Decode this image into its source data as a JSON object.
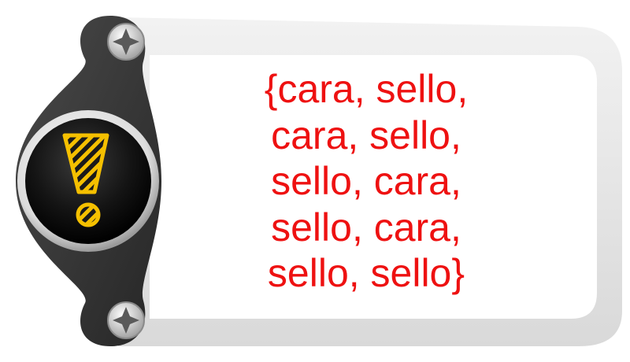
{
  "colors": {
    "text": "#ee1111",
    "frame_outer": "#e8e8e8",
    "frame_inner": "#ffffff",
    "holder": "#3a3a3a",
    "button": "#111111",
    "symbol": "#f5c000"
  },
  "icons": {
    "badge": "exclamation-icon",
    "top_screw": "screw-icon",
    "bottom_screw": "screw-icon"
  },
  "content": {
    "lines": [
      "{cara, sello,",
      "cara, sello,",
      "sello, cara,",
      "sello, cara,",
      "sello, sello}"
    ]
  }
}
